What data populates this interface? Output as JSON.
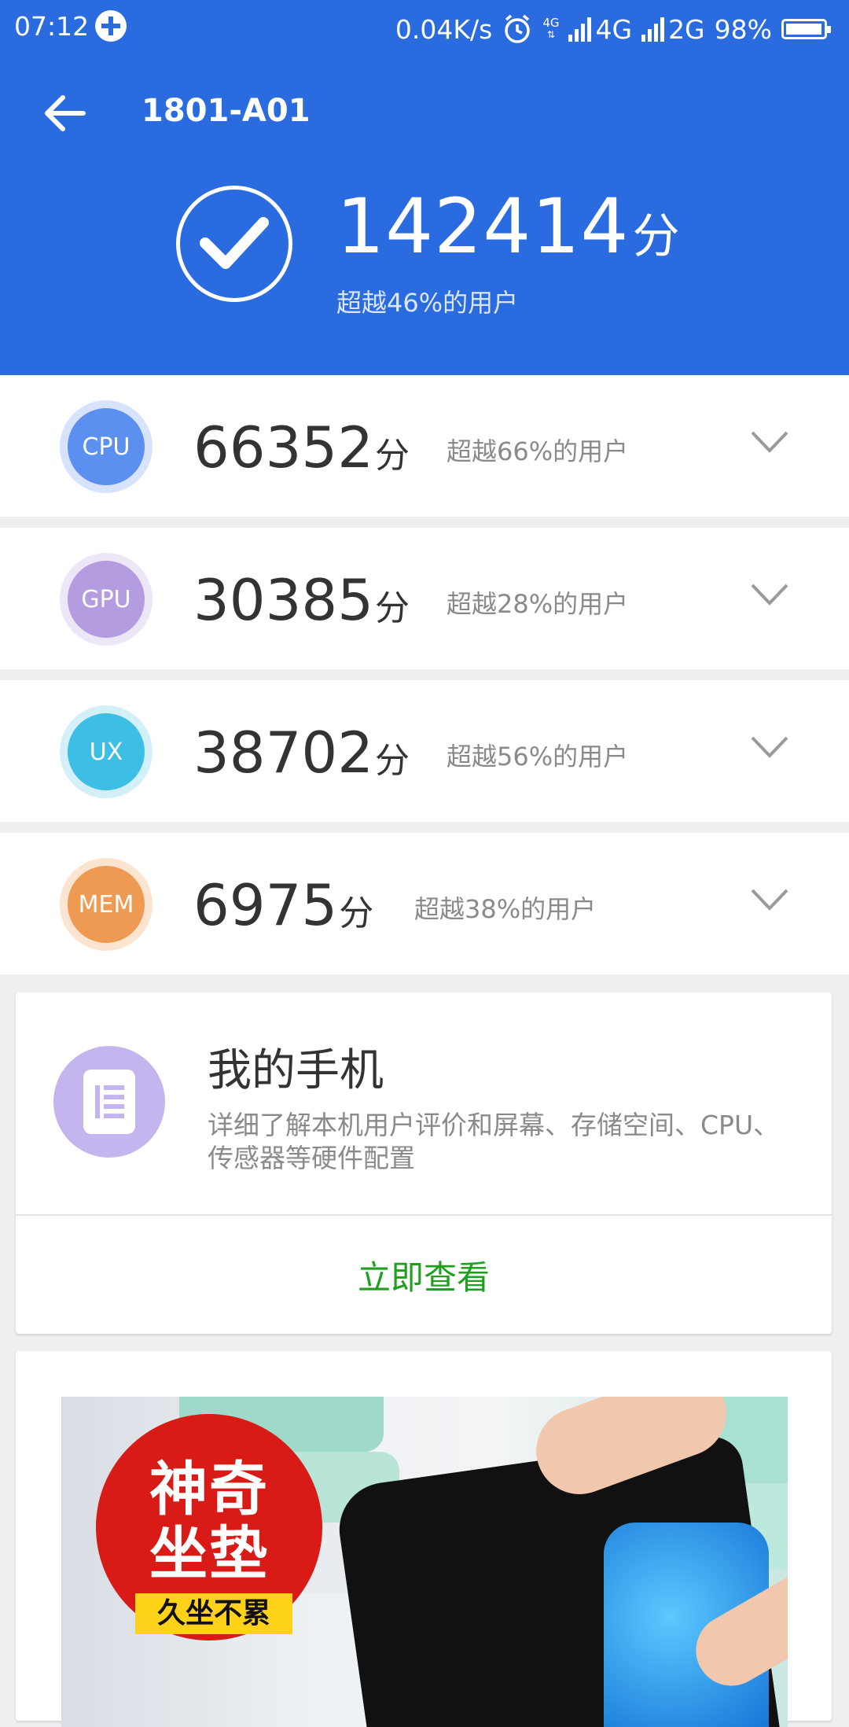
{
  "status_bar": {
    "time": "07:12",
    "network_speed": "0.04K/s",
    "small_4g": "4G",
    "signal1_label": "4G",
    "signal2_label": "2G",
    "battery": "98%"
  },
  "header": {
    "device_name": "1801-A01",
    "total_score": "142414",
    "score_unit": "分",
    "total_rank": "超越46%的用户"
  },
  "scores": [
    {
      "label": "CPU",
      "score": "66352",
      "unit": "分",
      "rank": "超越66%的用户",
      "color": "#5b8ff0",
      "ring": "#d7e3fb"
    },
    {
      "label": "GPU",
      "score": "30385",
      "unit": "分",
      "rank": "超越28%的用户",
      "color": "#b49ce0",
      "ring": "#ece6f7"
    },
    {
      "label": "UX",
      "score": "38702",
      "unit": "分",
      "rank": "超越56%的用户",
      "color": "#3dbfe5",
      "ring": "#d3f0f9"
    },
    {
      "label": "MEM",
      "score": "6975",
      "unit": "分",
      "rank": "超越38%的用户",
      "color": "#ef9a52",
      "ring": "#fbe5d1"
    }
  ],
  "my_phone": {
    "title": "我的手机",
    "description": "详细了解本机用户评价和屏幕、存储空间、CPU、传感器等硬件配置",
    "action": "立即查看"
  },
  "ad": {
    "headline_line1": "神奇",
    "headline_line2": "坐垫",
    "tagline": "久坐不累"
  },
  "icons": {
    "back": "arrow-left-icon",
    "check": "check-circle-icon",
    "chevron": "chevron-down-icon",
    "phone": "document-icon"
  }
}
